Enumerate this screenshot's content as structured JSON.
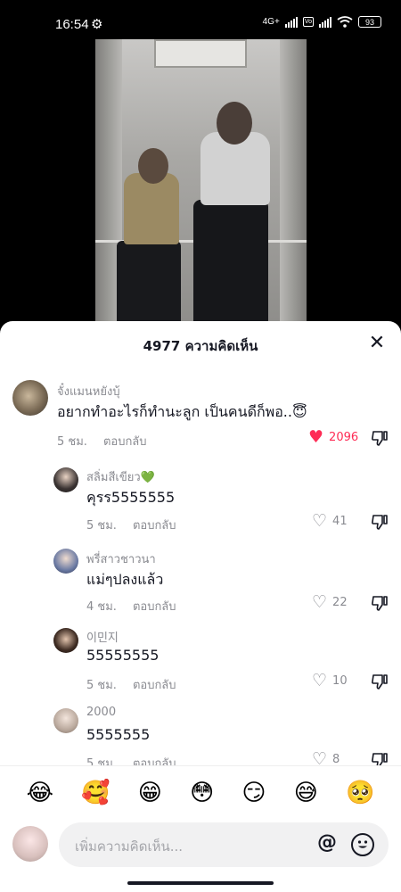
{
  "status_bar": {
    "time": "16:54",
    "network": "4G+",
    "vo_badge": "Vo",
    "battery": "93"
  },
  "sheet": {
    "title": "4977 ความคิดเห็น"
  },
  "labels": {
    "reply": "ตอบกลับ"
  },
  "comments": [
    {
      "username": "จั๋งแมนหยังบุ้",
      "text": "อยากทำอะไรก็ทำนะลูก เป็นคนดีก็พอ..😇",
      "time": "5 ชม.",
      "likes": "2096",
      "liked": true
    },
    {
      "username": "สลิ่มสีเขียว💚",
      "text": "คุรร5555555",
      "time": "5 ชม.",
      "likes": "41",
      "liked": false
    },
    {
      "username": "พรี่สาวชาวนา",
      "text": "แม่ๆปลงแล้ว",
      "time": "4 ชม.",
      "likes": "22",
      "liked": false
    },
    {
      "username": "이민지",
      "text": "55555555",
      "time": "5 ชม.",
      "likes": "10",
      "liked": false
    },
    {
      "username": "2000",
      "text": "5555555",
      "time": "5 ชม.",
      "likes": "8",
      "liked": false
    }
  ],
  "emoji_bar": [
    "😂",
    "🥰",
    "😁",
    "😳",
    "😏",
    "😅",
    "🥺"
  ],
  "input": {
    "placeholder": "เพิ่มความคิดเห็น...",
    "at_label": "@"
  },
  "colors": {
    "accent_like": "#fe2c55",
    "text_primary": "#161823",
    "text_secondary": "#8a8b91"
  }
}
